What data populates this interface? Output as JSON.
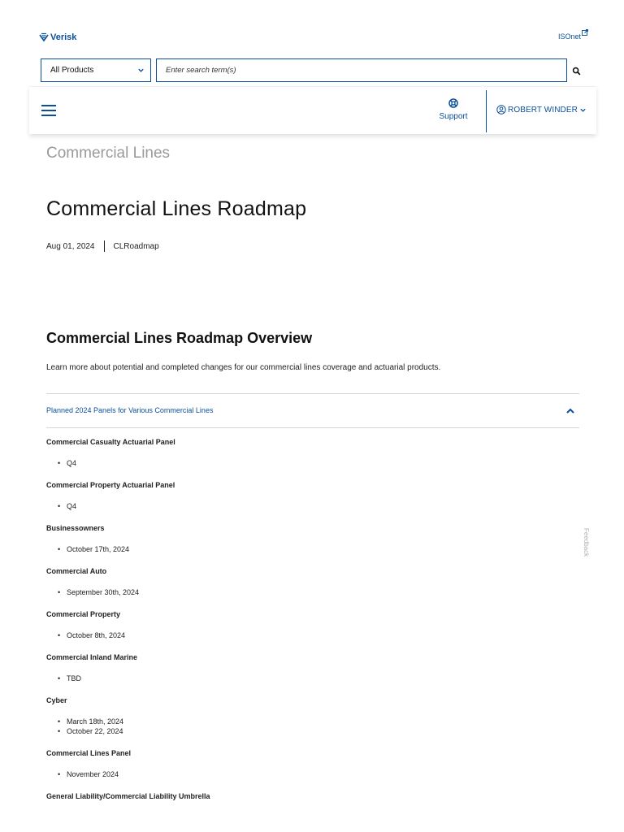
{
  "brand": {
    "name": "Verisk",
    "external_link": "ISOnet"
  },
  "search": {
    "product_filter": "All Products",
    "placeholder": "Enter search term(s)"
  },
  "navbar": {
    "support_label": "Support",
    "user_name": "ROBERT WINDER"
  },
  "breadcrumb": "Commercial Lines",
  "article": {
    "title": "Commercial Lines Roadmap",
    "date": "Aug 01, 2024",
    "tag": "CLRoadmap",
    "section_title": "Commercial Lines Roadmap Overview",
    "intro": "Learn more about potential and completed changes for our commercial lines coverage and actuarial products."
  },
  "accordion": {
    "label": "Planned 2024 Panels for Various Commercial Lines",
    "expanded": true
  },
  "panels": [
    {
      "name": "Commercial Casualty Actuarial Panel",
      "dates": [
        "Q4"
      ]
    },
    {
      "name": "Commercial Property Actuarial Panel",
      "dates": [
        "Q4"
      ]
    },
    {
      "name": "Businessowners",
      "dates": [
        "October 17th, 2024"
      ]
    },
    {
      "name": "Commercial Auto",
      "dates": [
        "September 30th, 2024"
      ]
    },
    {
      "name": "Commercial Property",
      "dates": [
        "October 8th, 2024"
      ]
    },
    {
      "name": "Commercial Inland Marine",
      "dates": [
        "TBD"
      ]
    },
    {
      "name": "Cyber",
      "dates": [
        "March 18th, 2024",
        "October 22, 2024"
      ]
    },
    {
      "name": "Commercial Lines Panel",
      "dates": [
        "November 2024"
      ]
    },
    {
      "name": "General Liability/Commercial Liability Umbrella",
      "dates": []
    }
  ],
  "feedback_label": "Feedback",
  "colors": {
    "brand_blue": "#0b4f9c",
    "muted_gray": "#9a9a9a"
  }
}
